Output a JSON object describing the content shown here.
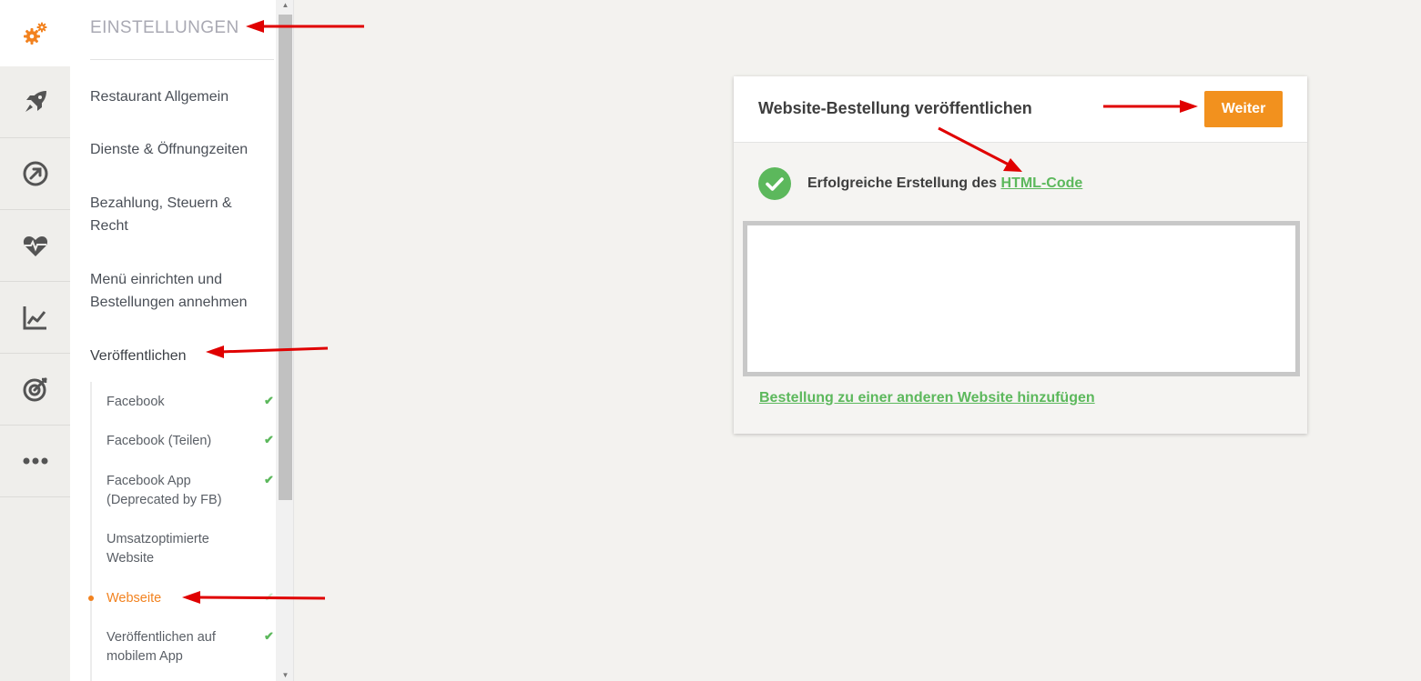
{
  "rail": {
    "items": [
      {
        "icon": "gears-icon",
        "active": true
      },
      {
        "icon": "rocket-icon"
      },
      {
        "icon": "circular-arrow-icon"
      },
      {
        "icon": "heartbeat-icon"
      },
      {
        "icon": "line-chart-icon"
      },
      {
        "icon": "target-icon"
      },
      {
        "icon": "more-icon"
      }
    ]
  },
  "sidebar": {
    "title": "EINSTELLUNGEN",
    "items": [
      {
        "label": "Restaurant Allgemein"
      },
      {
        "label": "Dienste & Öffnungzeiten"
      },
      {
        "label": "Bezahlung, Steuern & Recht"
      },
      {
        "label": "Menü einrichten und Bestellungen annehmen"
      },
      {
        "label": "Veröffentlichen"
      }
    ],
    "subitems": [
      {
        "label": "Facebook",
        "checked": true
      },
      {
        "label": "Facebook (Teilen)",
        "checked": true
      },
      {
        "label": "Facebook App (Deprecated by FB)",
        "checked": true
      },
      {
        "label": "Umsatzoptimierte Website",
        "checked": false
      },
      {
        "label": "Webseite",
        "checked": true,
        "active": true
      },
      {
        "label": "Veröffentlichen auf mobilem App",
        "checked": true
      }
    ]
  },
  "card": {
    "title": "Website-Bestellung veröffentlichen",
    "next_label": "Weiter",
    "success_text": "Erfolgreiche Erstellung des",
    "success_link": "HTML-Code",
    "code_value": "",
    "add_link": "Bestellung zu einer anderen Website hinzufügen"
  },
  "colors": {
    "accent": "#f2821f",
    "button": "#f2911e",
    "success": "#5cb85c",
    "annotation": "#e00000"
  }
}
